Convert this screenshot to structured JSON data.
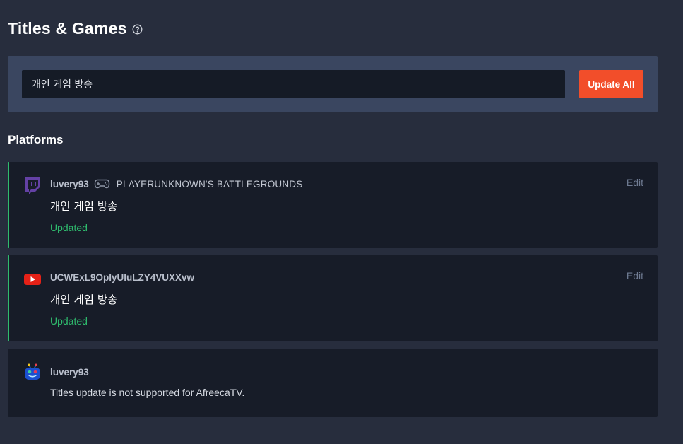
{
  "header": {
    "title": "Titles & Games",
    "help_icon": "question-circle-icon"
  },
  "update_panel": {
    "title_value": "개인 게임 방송",
    "update_all_label": "Update All"
  },
  "platforms_section": {
    "title": "Platforms",
    "items": [
      {
        "platform": "Twitch",
        "icon": "twitch-icon",
        "account": "luvery93",
        "game_icon": "gamepad-icon",
        "game": "PLAYERUNKNOWN'S BATTLEGROUNDS",
        "stream_title": "개인 게임 방송",
        "status": "Updated",
        "edit_label": "Edit"
      },
      {
        "platform": "YouTube",
        "icon": "youtube-icon",
        "account": "UCWExL9OpIyUluLZY4VUXXvw",
        "stream_title": "개인 게임 방송",
        "status": "Updated",
        "edit_label": "Edit"
      },
      {
        "platform": "AfreecaTV",
        "icon": "afreecatv-icon",
        "account": "luvery93",
        "message": "Titles update is not supported for AfreecaTV."
      }
    ]
  },
  "colors": {
    "background": "#272d3d",
    "panel": "#3a4660",
    "card": "#171c28",
    "accent_button": "#f24e2a",
    "success": "#2fbc6e",
    "twitch": "#6441a5",
    "youtube": "#e62117"
  }
}
